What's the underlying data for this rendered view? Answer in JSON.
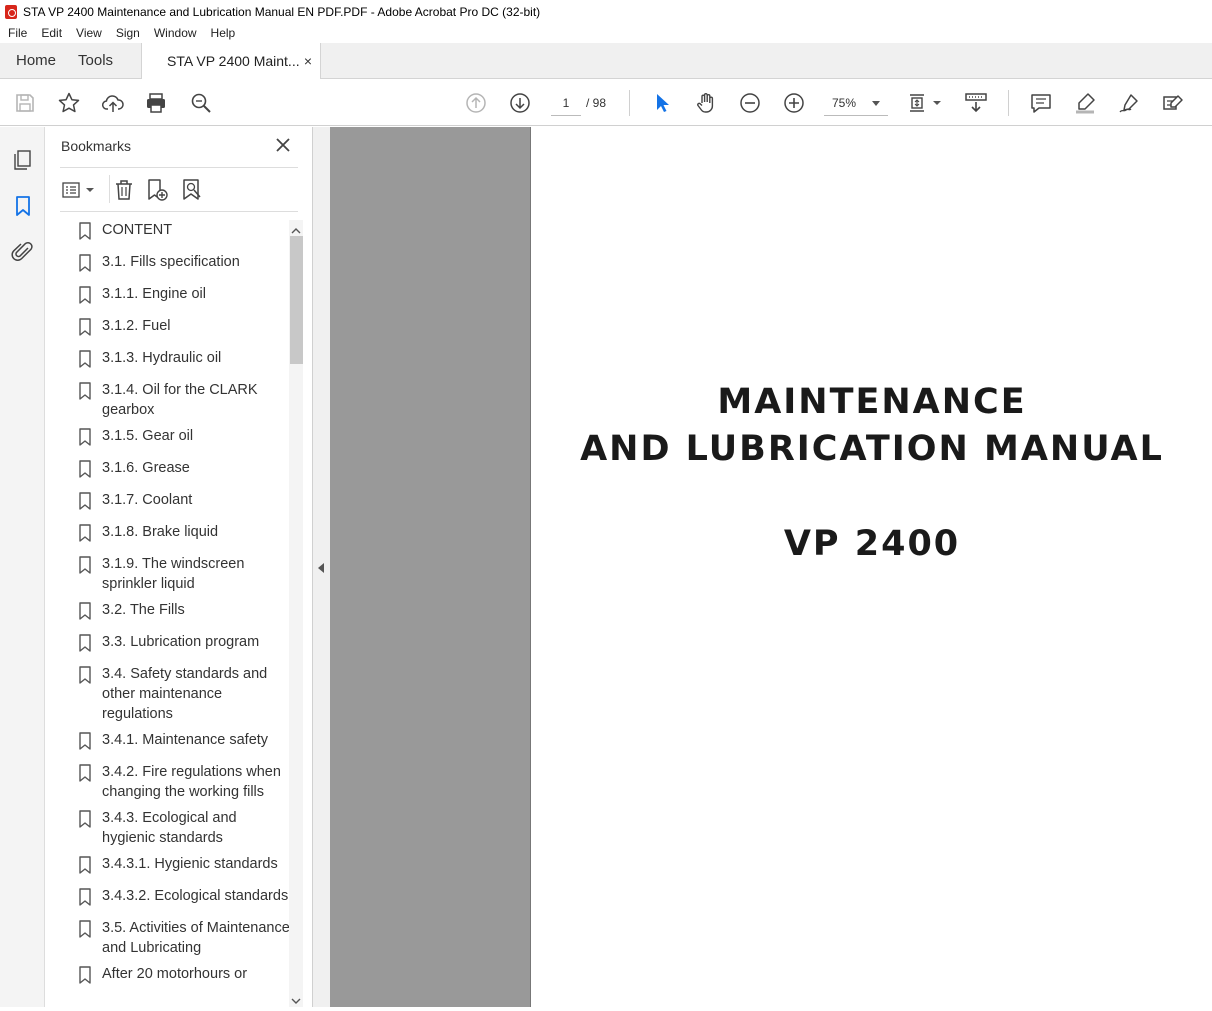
{
  "window": {
    "title": "STA VP 2400 Maintenance and Lubrication Manual EN PDF.PDF - Adobe Acrobat Pro DC (32-bit)"
  },
  "menu": {
    "items": [
      "File",
      "Edit",
      "View",
      "Sign",
      "Window",
      "Help"
    ]
  },
  "tabs": {
    "home": "Home",
    "tools": "Tools",
    "doc": "STA VP 2400 Maint...",
    "close": "×"
  },
  "toolbar": {
    "page_current": "1",
    "page_total": "/ 98",
    "zoom": "75%"
  },
  "bookmarks": {
    "title": "Bookmarks",
    "items": [
      "CONTENT",
      "3.1. Fills specification",
      "3.1.1. Engine oil",
      "3.1.2. Fuel",
      "3.1.3. Hydraulic oil",
      "3.1.4. Oil for the CLARK gearbox",
      "3.1.5. Gear oil",
      "3.1.6. Grease",
      "3.1.7. Coolant",
      "3.1.8. Brake liquid",
      "3.1.9. The windscreen sprinkler liquid",
      "3.2. The Fills",
      "3.3. Lubrication program",
      "3.4. Safety standards and other maintenance regulations",
      "3.4.1. Maintenance safety",
      "3.4.2. Fire regulations when changing the working fills",
      "3.4.3. Ecological and hygienic standards",
      "3.4.3.1. Hygienic standards",
      "3.4.3.2. Ecological standards",
      "3.5. Activities of Maintenance and Lubricating",
      "After 20 motorhours or"
    ]
  },
  "document": {
    "line1": "MAINTENANCE",
    "line2": "AND LUBRICATION MANUAL",
    "line3": "VP 2400"
  },
  "colors": {
    "accent": "#1473e6",
    "gray_bg": "#999999",
    "acrobat_red": "#d7261b"
  }
}
